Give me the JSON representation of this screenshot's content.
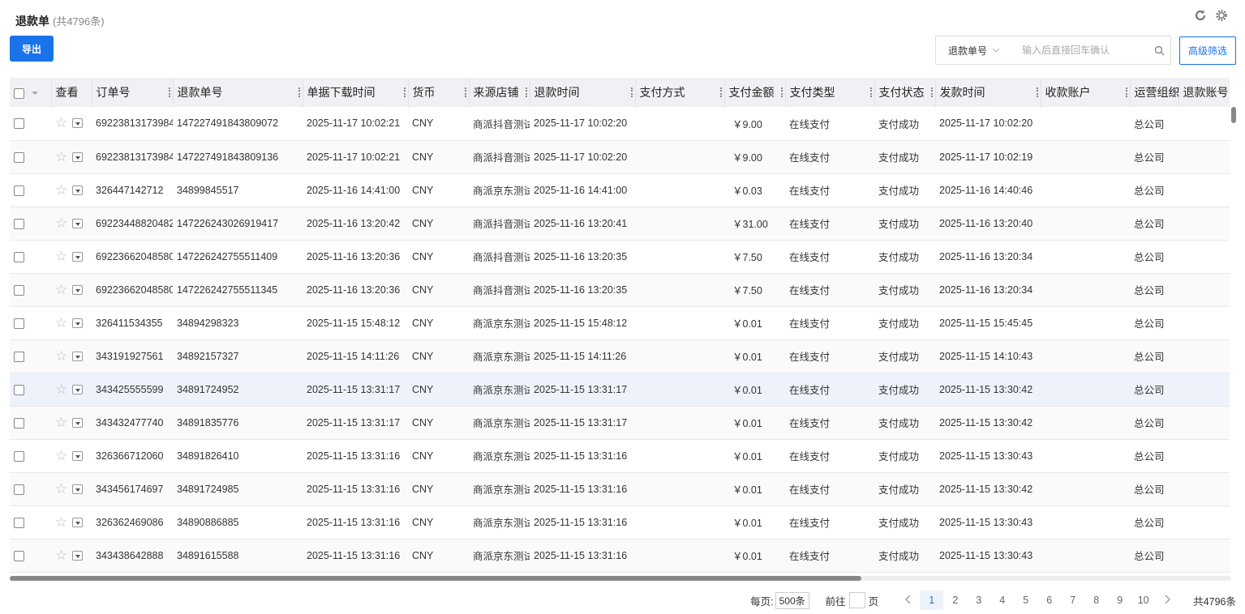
{
  "header": {
    "title": "退款单",
    "count": "(共4796条)"
  },
  "toolbar": {
    "export_label": "导出",
    "advanced_filter_label": "高级筛选"
  },
  "search": {
    "field": "退款单号",
    "placeholder": "输入后直接回车确认"
  },
  "table": {
    "columns": [
      "查看",
      "订单号",
      "退款单号",
      "单据下载时间",
      "货币",
      "来源店铺",
      "退款时间",
      "支付方式",
      "支付金额",
      "支付类型",
      "支付状态",
      "发款时间",
      "收款账户",
      "运营组织",
      "退款账号"
    ],
    "rows": [
      {
        "order": "69223813173984",
        "refund": "147227491843809072",
        "download": "2025-11-17 10:02:21",
        "currency": "CNY",
        "store": "商派抖音测试",
        "refund_time": "2025-11-17 10:02:20",
        "pay_method": "",
        "amount": "￥9.00",
        "pay_type": "在线支付",
        "pay_status": "支付成功",
        "pay_time": "2025-11-17 10:02:20",
        "account": "",
        "org": "总公司",
        "refund_acct": ""
      },
      {
        "order": "69223813173984",
        "refund": "147227491843809136",
        "download": "2025-11-17 10:02:21",
        "currency": "CNY",
        "store": "商派抖音测试",
        "refund_time": "2025-11-17 10:02:20",
        "pay_method": "",
        "amount": "￥9.00",
        "pay_type": "在线支付",
        "pay_status": "支付成功",
        "pay_time": "2025-11-17 10:02:19",
        "account": "",
        "org": "总公司",
        "refund_acct": ""
      },
      {
        "order": "326447142712",
        "refund": "34899845517",
        "download": "2025-11-16 14:41:00",
        "currency": "CNY",
        "store": "商派京东测试",
        "refund_time": "2025-11-16 14:41:00",
        "pay_method": "",
        "amount": "￥0.03",
        "pay_type": "在线支付",
        "pay_status": "支付成功",
        "pay_time": "2025-11-16 14:40:46",
        "account": "",
        "org": "总公司",
        "refund_acct": ""
      },
      {
        "order": "69223448820482",
        "refund": "147226243026919417",
        "download": "2025-11-16 13:20:42",
        "currency": "CNY",
        "store": "商派抖音测试",
        "refund_time": "2025-11-16 13:20:41",
        "pay_method": "",
        "amount": "￥31.00",
        "pay_type": "在线支付",
        "pay_status": "支付成功",
        "pay_time": "2025-11-16 13:20:40",
        "account": "",
        "org": "总公司",
        "refund_acct": ""
      },
      {
        "order": "69223662048580",
        "refund": "147226242755511409",
        "download": "2025-11-16 13:20:36",
        "currency": "CNY",
        "store": "商派抖音测试",
        "refund_time": "2025-11-16 13:20:35",
        "pay_method": "",
        "amount": "￥7.50",
        "pay_type": "在线支付",
        "pay_status": "支付成功",
        "pay_time": "2025-11-16 13:20:34",
        "account": "",
        "org": "总公司",
        "refund_acct": ""
      },
      {
        "order": "69223662048580",
        "refund": "147226242755511345",
        "download": "2025-11-16 13:20:36",
        "currency": "CNY",
        "store": "商派抖音测试",
        "refund_time": "2025-11-16 13:20:35",
        "pay_method": "",
        "amount": "￥7.50",
        "pay_type": "在线支付",
        "pay_status": "支付成功",
        "pay_time": "2025-11-16 13:20:34",
        "account": "",
        "org": "总公司",
        "refund_acct": ""
      },
      {
        "order": "326411534355",
        "refund": "34894298323",
        "download": "2025-11-15 15:48:12",
        "currency": "CNY",
        "store": "商派京东测试",
        "refund_time": "2025-11-15 15:48:12",
        "pay_method": "",
        "amount": "￥0.01",
        "pay_type": "在线支付",
        "pay_status": "支付成功",
        "pay_time": "2025-11-15 15:45:45",
        "account": "",
        "org": "总公司",
        "refund_acct": ""
      },
      {
        "order": "343191927561",
        "refund": "34892157327",
        "download": "2025-11-15 14:11:26",
        "currency": "CNY",
        "store": "商派京东测试",
        "refund_time": "2025-11-15 14:11:26",
        "pay_method": "",
        "amount": "￥0.01",
        "pay_type": "在线支付",
        "pay_status": "支付成功",
        "pay_time": "2025-11-15 14:10:43",
        "account": "",
        "org": "总公司",
        "refund_acct": ""
      },
      {
        "order": "343425555599",
        "refund": "34891724952",
        "download": "2025-11-15 13:31:17",
        "currency": "CNY",
        "store": "商派京东测试",
        "refund_time": "2025-11-15 13:31:17",
        "pay_method": "",
        "amount": "￥0.01",
        "pay_type": "在线支付",
        "pay_status": "支付成功",
        "pay_time": "2025-11-15 13:30:42",
        "account": "",
        "org": "总公司",
        "refund_acct": ""
      },
      {
        "order": "343432477740",
        "refund": "34891835776",
        "download": "2025-11-15 13:31:17",
        "currency": "CNY",
        "store": "商派京东测试",
        "refund_time": "2025-11-15 13:31:17",
        "pay_method": "",
        "amount": "￥0.01",
        "pay_type": "在线支付",
        "pay_status": "支付成功",
        "pay_time": "2025-11-15 13:30:42",
        "account": "",
        "org": "总公司",
        "refund_acct": ""
      },
      {
        "order": "326366712060",
        "refund": "34891826410",
        "download": "2025-11-15 13:31:16",
        "currency": "CNY",
        "store": "商派京东测试",
        "refund_time": "2025-11-15 13:31:16",
        "pay_method": "",
        "amount": "￥0.01",
        "pay_type": "在线支付",
        "pay_status": "支付成功",
        "pay_time": "2025-11-15 13:30:43",
        "account": "",
        "org": "总公司",
        "refund_acct": ""
      },
      {
        "order": "343456174697",
        "refund": "34891724985",
        "download": "2025-11-15 13:31:16",
        "currency": "CNY",
        "store": "商派京东测试",
        "refund_time": "2025-11-15 13:31:16",
        "pay_method": "",
        "amount": "￥0.01",
        "pay_type": "在线支付",
        "pay_status": "支付成功",
        "pay_time": "2025-11-15 13:30:42",
        "account": "",
        "org": "总公司",
        "refund_acct": ""
      },
      {
        "order": "326362469086",
        "refund": "34890886885",
        "download": "2025-11-15 13:31:16",
        "currency": "CNY",
        "store": "商派京东测试",
        "refund_time": "2025-11-15 13:31:16",
        "pay_method": "",
        "amount": "￥0.01",
        "pay_type": "在线支付",
        "pay_status": "支付成功",
        "pay_time": "2025-11-15 13:30:43",
        "account": "",
        "org": "总公司",
        "refund_acct": ""
      },
      {
        "order": "343438642888",
        "refund": "34891615588",
        "download": "2025-11-15 13:31:16",
        "currency": "CNY",
        "store": "商派京东测试",
        "refund_time": "2025-11-15 13:31:16",
        "pay_method": "",
        "amount": "￥0.01",
        "pay_type": "在线支付",
        "pay_status": "支付成功",
        "pay_time": "2025-11-15 13:30:43",
        "account": "",
        "org": "总公司",
        "refund_acct": ""
      }
    ]
  },
  "pagination": {
    "per_page_label": "每页:",
    "per_page_value": "500条",
    "goto_label": "前往",
    "page_unit": "页",
    "pages": [
      "1",
      "2",
      "3",
      "4",
      "5",
      "6",
      "7",
      "8",
      "9",
      "10"
    ],
    "current": "1",
    "total": "共4796条"
  },
  "colors": {
    "accent": "#1a73e8",
    "header_bg": "#f0f1f4",
    "highlight_row": "#eef3fb"
  },
  "icons": {
    "refresh": "refresh-icon",
    "settings": "gear-icon",
    "search": "search-icon",
    "prev": "chevron-left-icon",
    "next": "chevron-right-icon"
  }
}
